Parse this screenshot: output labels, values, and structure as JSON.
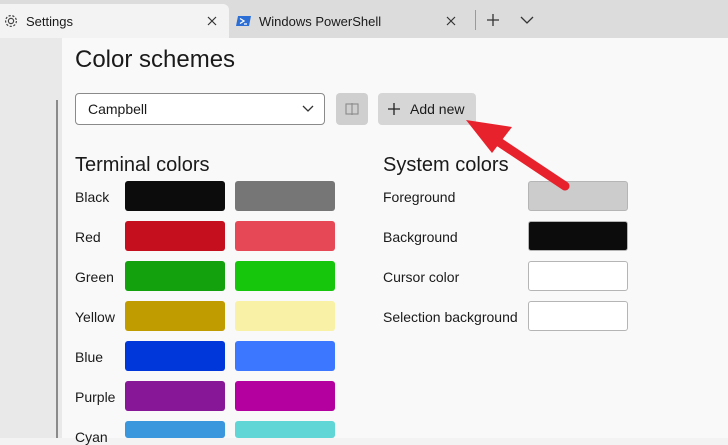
{
  "tabs": [
    {
      "label": "Settings",
      "icon": "gear-icon",
      "active": true
    },
    {
      "label": "Windows PowerShell",
      "icon": "powershell-icon",
      "active": false
    }
  ],
  "page": {
    "title": "Color schemes"
  },
  "scheme_select": {
    "value": "Campbell"
  },
  "buttons": {
    "add_new": "Add new"
  },
  "terminal_colors": {
    "title": "Terminal colors",
    "rows": [
      {
        "label": "Black",
        "color": "#0c0c0c",
        "bright": "#767676"
      },
      {
        "label": "Red",
        "color": "#c50f1f",
        "bright": "#e74856"
      },
      {
        "label": "Green",
        "color": "#13a10e",
        "bright": "#16c60c"
      },
      {
        "label": "Yellow",
        "color": "#c19c00",
        "bright": "#f9f1a5"
      },
      {
        "label": "Blue",
        "color": "#0037da",
        "bright": "#3b78ff"
      },
      {
        "label": "Purple",
        "color": "#881798",
        "bright": "#b4009e"
      },
      {
        "label": "Cyan",
        "color": "#3a96dd",
        "bright": "#61d6d6"
      }
    ]
  },
  "system_colors": {
    "title": "System colors",
    "rows": [
      {
        "label": "Foreground",
        "color": "#cccccc"
      },
      {
        "label": "Background",
        "color": "#0c0c0c"
      },
      {
        "label": "Cursor color",
        "color": "#ffffff"
      },
      {
        "label": "Selection background",
        "color": "#ffffff"
      }
    ]
  },
  "annotation": {
    "arrow_color": "#e8222d"
  }
}
